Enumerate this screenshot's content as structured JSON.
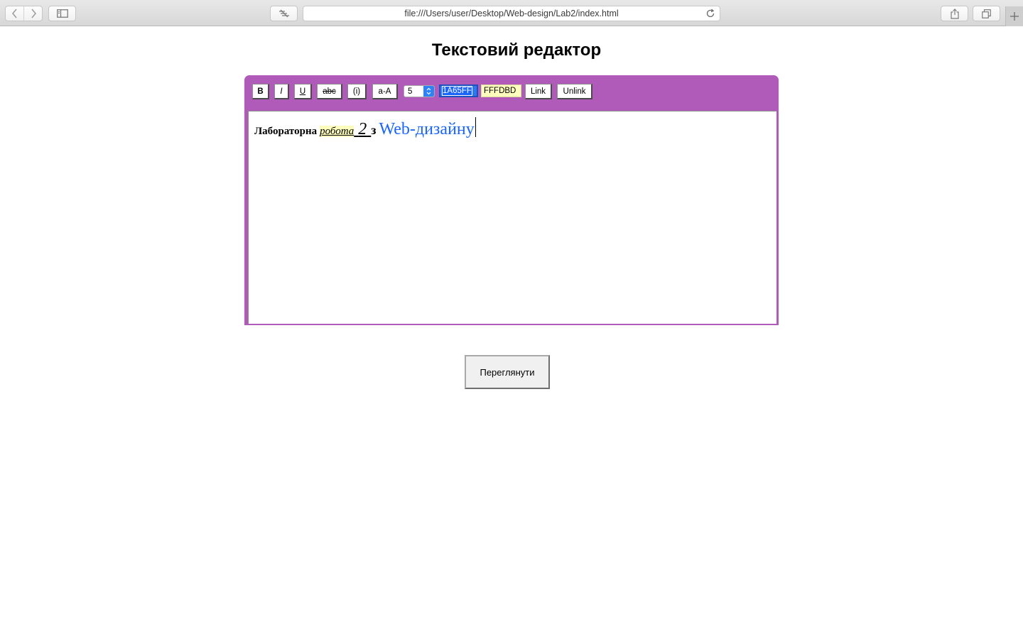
{
  "browser": {
    "url": "file:///Users/user/Desktop/Web-design/Lab2/index.html"
  },
  "page": {
    "title": "Текстовий редактор"
  },
  "toolbar": {
    "bold_label": "B",
    "italic_label": "I",
    "underline_label": "U",
    "strike_label": "abc",
    "info_label": "(i)",
    "case_label": "a-A",
    "font_size_value": "5",
    "fore_color_value": "1A65FF",
    "back_color_value": "FFFDBD",
    "link_label": "Link",
    "unlink_label": "Unlink"
  },
  "document": {
    "segments": {
      "word1": "Лабораторна",
      "word2": "робота",
      "word3": "2",
      "word4": "з",
      "word5": "Web-дизайну"
    }
  },
  "actions": {
    "preview_label": "Переглянути"
  },
  "colors": {
    "toolbar_bg": "#b05ab9",
    "fore_color": "#1a65ff",
    "highlight": "#ffffbd"
  }
}
